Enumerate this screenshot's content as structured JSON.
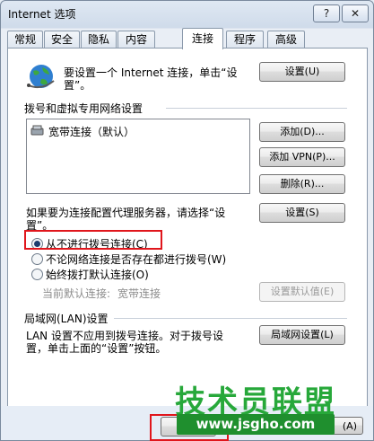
{
  "window": {
    "title": "Internet 选项",
    "help_label": "?",
    "close_label": "✕"
  },
  "tabs": [
    "常规",
    "安全",
    "隐私",
    "内容",
    "连接",
    "程序",
    "高级"
  ],
  "active_tab": "连接",
  "setup": {
    "text_line1": "要设置一个 Internet 连接，单击“设",
    "text_line2": "置”。",
    "button": "设置(U)"
  },
  "dialup": {
    "heading": "拨号和虚拟专用网络设置",
    "list_item": "宽带连接（默认）",
    "buttons": [
      "添加(D)...",
      "添加 VPN(P)...",
      "删除(R)...",
      "设置(S)"
    ],
    "proxy_text_line1": "如果要为连接配置代理服务器，请选择“设",
    "proxy_text_line2": "置”。",
    "radios": [
      "从不进行拨号连接(C)",
      "不论网络连接是否存在都进行拨号(W)",
      "始终拨打默认连接(O)"
    ],
    "selected_radio": 0,
    "current_default_label": "当前默认连接:",
    "current_default_value": "宽带连接",
    "set_default_button": "设置默认值(E)"
  },
  "lan": {
    "heading": "局域网(LAN)设置",
    "text_line1": "LAN 设置不应用到拨号连接。对于拨号设",
    "text_line2": "置，单击上面的“设置”按钮。",
    "button": "局域网设置(L)"
  },
  "footer": {
    "apply_partial": "(A)"
  },
  "watermark": {
    "text": "技术员联盟",
    "url": "www.jsgho.com"
  },
  "colors": {
    "highlight": "#e0161c",
    "watermark_green": "#27a83a"
  }
}
